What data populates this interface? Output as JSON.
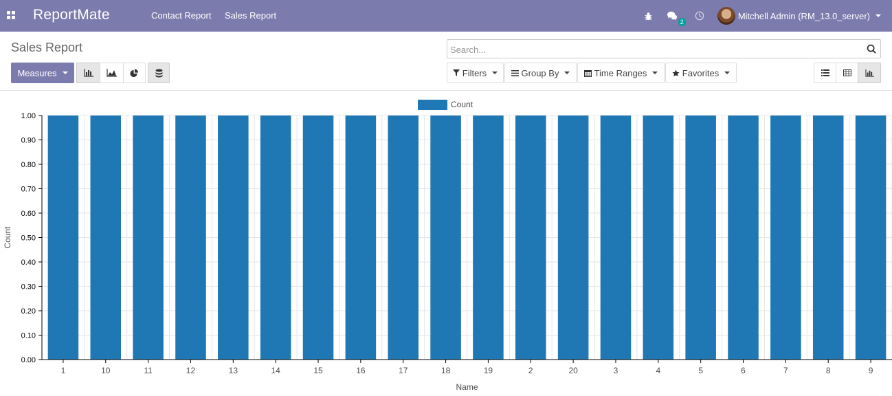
{
  "navbar": {
    "brand": "ReportMate",
    "menu": [
      "Contact Report",
      "Sales Report"
    ],
    "messages_badge": "2",
    "user_name": "Mitchell Admin (RM_13.0_server)",
    "icons": [
      "apps-icon",
      "bug-icon",
      "chat-icon",
      "clock-icon"
    ]
  },
  "control_panel": {
    "title": "Sales Report",
    "search_placeholder": "Search...",
    "measures_label": "Measures",
    "filters_label": "Filters",
    "group_by_label": "Group By",
    "time_ranges_label": "Time Ranges",
    "favorites_label": "Favorites",
    "chart_type_buttons": [
      "bar-chart-icon",
      "line-chart-icon",
      "pie-chart-icon",
      "stack-icon"
    ],
    "view_buttons": [
      "list-view-icon",
      "pivot-view-icon",
      "graph-view-icon"
    ],
    "active_chart_type": "bar",
    "active_view": "graph"
  },
  "chart_data": {
    "type": "bar",
    "categories": [
      "1",
      "10",
      "11",
      "12",
      "13",
      "14",
      "15",
      "16",
      "17",
      "18",
      "19",
      "2",
      "20",
      "3",
      "4",
      "5",
      "6",
      "7",
      "8",
      "9"
    ],
    "series": [
      {
        "name": "Count",
        "values": [
          1,
          1,
          1,
          1,
          1,
          1,
          1,
          1,
          1,
          1,
          1,
          1,
          1,
          1,
          1,
          1,
          1,
          1,
          1,
          1
        ]
      }
    ],
    "yticks": [
      "0.00",
      "0.10",
      "0.20",
      "0.30",
      "0.40",
      "0.50",
      "0.60",
      "0.70",
      "0.80",
      "0.90",
      "1.00"
    ],
    "ylim": [
      0,
      1
    ],
    "xlabel": "Name",
    "ylabel": "Count",
    "legend_position": "top",
    "bar_color": "#1f77b4",
    "grid": true
  }
}
